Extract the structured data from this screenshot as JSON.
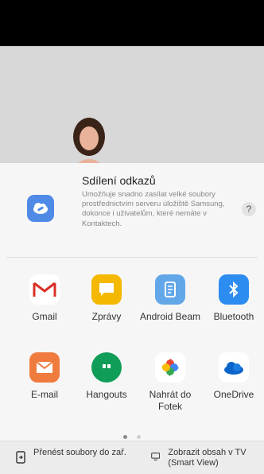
{
  "share": {
    "title": "Sdílení odkazů",
    "description": "Umožňuje snadno zasílat velké soubory prostřednictvím serveru úložiště Samsung, dokonce i uživatelům, které nemáte v Kontaktech.",
    "help": "?"
  },
  "apps": [
    {
      "label": "Gmail",
      "icon": "gmail-icon",
      "color": "#ffffff"
    },
    {
      "label": "Zprávy",
      "icon": "messages-icon",
      "color": "#f5b800"
    },
    {
      "label": "Android Beam",
      "icon": "android-beam-icon",
      "color": "#62a7e8"
    },
    {
      "label": "Bluetooth",
      "icon": "bluetooth-icon",
      "color": "#2d8cf0"
    },
    {
      "label": "E-mail",
      "icon": "email-icon",
      "color": "#f07b3f"
    },
    {
      "label": "Hangouts",
      "icon": "hangouts-icon",
      "color": "#0f9d58"
    },
    {
      "label": "Nahrát do Fotek",
      "icon": "google-photos-icon",
      "color": "#ffffff"
    },
    {
      "label": "OneDrive",
      "icon": "onedrive-icon",
      "color": "#ffffff"
    }
  ],
  "bottom": {
    "transfer": "Přenést soubory do zař.",
    "smart_view": "Zobrazit obsah v TV (Smart View)"
  }
}
